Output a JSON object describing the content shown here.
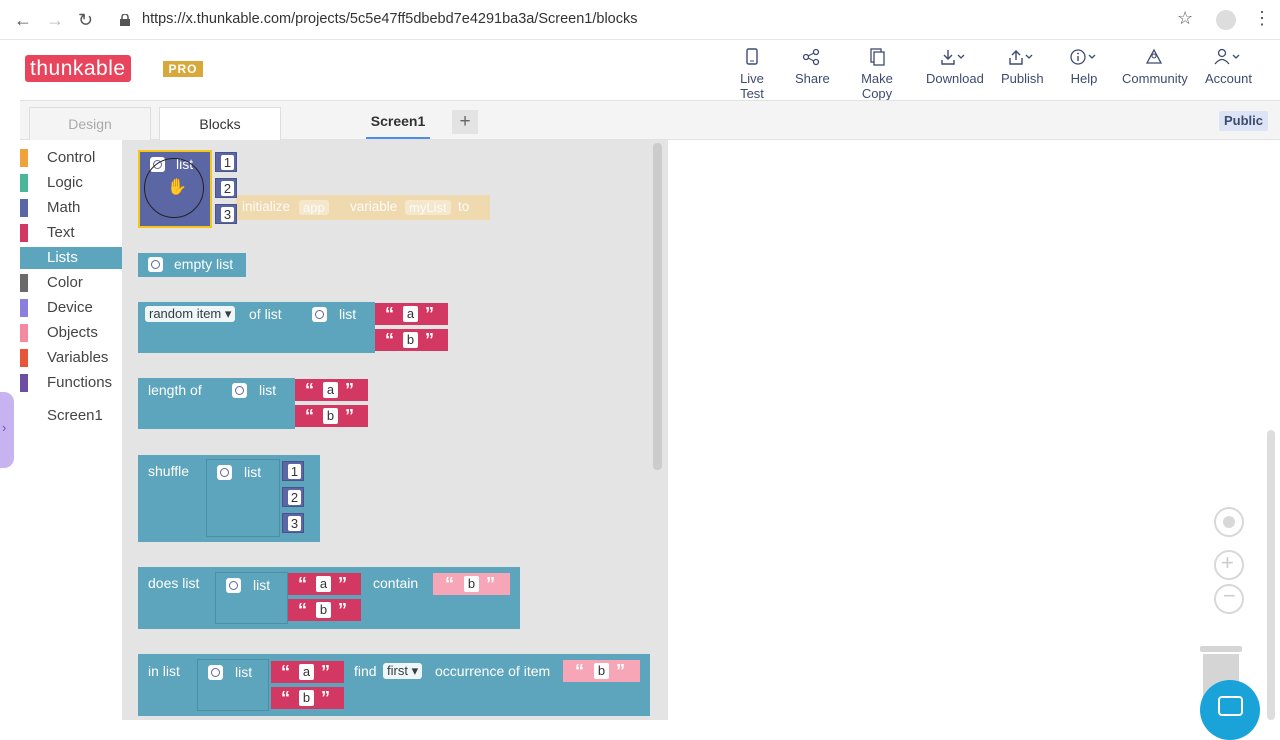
{
  "browser": {
    "url": "https://x.thunkable.com/projects/5c5e47ff5dbebd7e4291ba3a/Screen1/blocks"
  },
  "app": {
    "logo_text": "thunkable",
    "badge": "PRO",
    "toolbar": [
      {
        "label": "Live Test",
        "icon": "phone-icon"
      },
      {
        "label": "Share",
        "icon": "share-icon"
      },
      {
        "label": "Make Copy",
        "icon": "copy-icon"
      },
      {
        "label": "Download",
        "icon": "download-icon"
      },
      {
        "label": "Publish",
        "icon": "publish-icon"
      },
      {
        "label": "Help",
        "icon": "info-icon"
      },
      {
        "label": "Community",
        "icon": "community-icon"
      },
      {
        "label": "Account",
        "icon": "account-icon"
      }
    ]
  },
  "tabs": {
    "design": "Design",
    "blocks": "Blocks",
    "screen": "Screen1",
    "add": "+",
    "visibility": "Public"
  },
  "categories": [
    {
      "label": "Control",
      "color": "#f0a33a"
    },
    {
      "label": "Logic",
      "color": "#4bb79a"
    },
    {
      "label": "Math",
      "color": "#5b67a5"
    },
    {
      "label": "Text",
      "color": "#d33863"
    },
    {
      "label": "Lists",
      "color": "#5ca5bc",
      "active": true
    },
    {
      "label": "Color",
      "color": "#6a6a6a"
    },
    {
      "label": "Device",
      "color": "#8a7fe0"
    },
    {
      "label": "Objects",
      "color": "#f48aa0"
    },
    {
      "label": "Variables",
      "color": "#e7553b"
    },
    {
      "label": "Functions",
      "color": "#6b4ea1"
    },
    {
      "label": "Screen1",
      "color": ""
    }
  ],
  "blocks": {
    "list_label": "list",
    "nums": [
      "1",
      "2",
      "3"
    ],
    "ghost": {
      "initialize": "initialize",
      "scope": "app",
      "variable": "variable",
      "name": "myList",
      "to": "to"
    },
    "empty_list": "empty list",
    "random_item": "random item",
    "of_list": "of list",
    "str_a": "a",
    "str_b": "b",
    "length_of": "length of",
    "shuffle": "shuffle",
    "does_list": "does list",
    "contain": "contain",
    "in_list": "in list",
    "find": "find",
    "first": "first",
    "occurrence": "occurrence of item"
  }
}
